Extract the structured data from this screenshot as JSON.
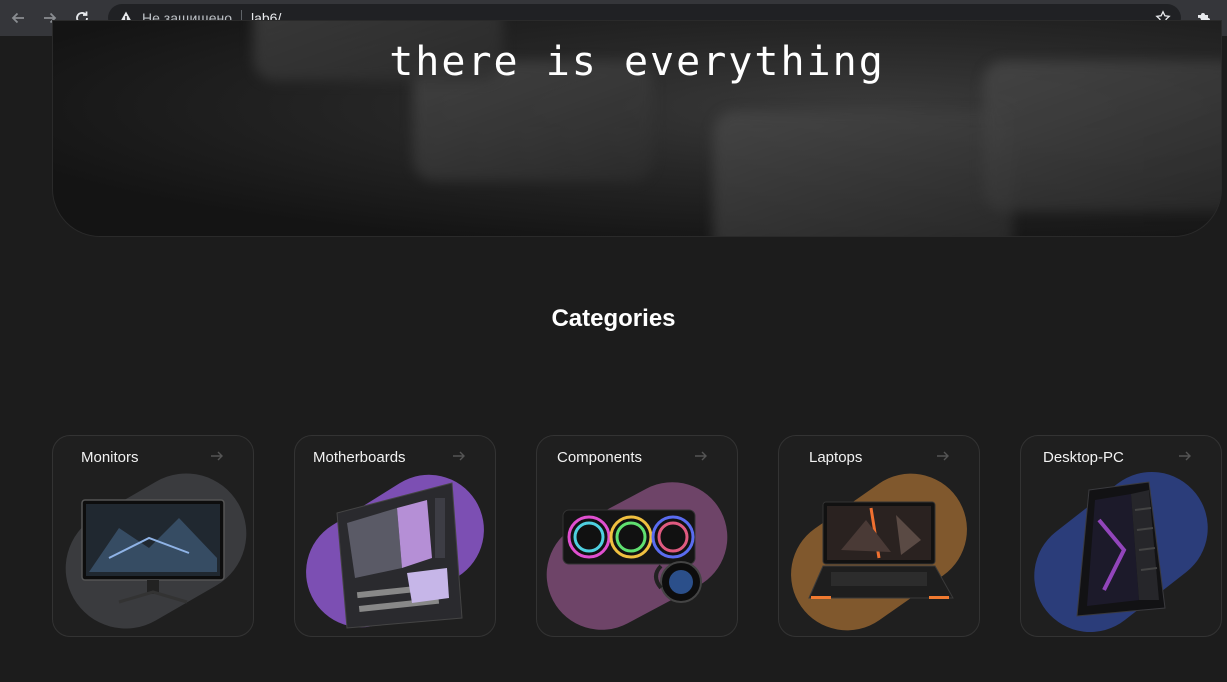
{
  "browser": {
    "security_label": "Не защищено",
    "url": "lab6/"
  },
  "hero": {
    "text": "there is everything"
  },
  "categories": {
    "title": "Categories",
    "items": [
      {
        "label": "Monitors",
        "blob_color": "#3a3b3e"
      },
      {
        "label": "Motherboards",
        "blob_color": "#7c4fb3"
      },
      {
        "label": "Components",
        "blob_color": "#6e4468"
      },
      {
        "label": "Laptops",
        "blob_color": "#80582d"
      },
      {
        "label": "Desktop-PC",
        "blob_color": "#2b3d7a"
      }
    ]
  }
}
